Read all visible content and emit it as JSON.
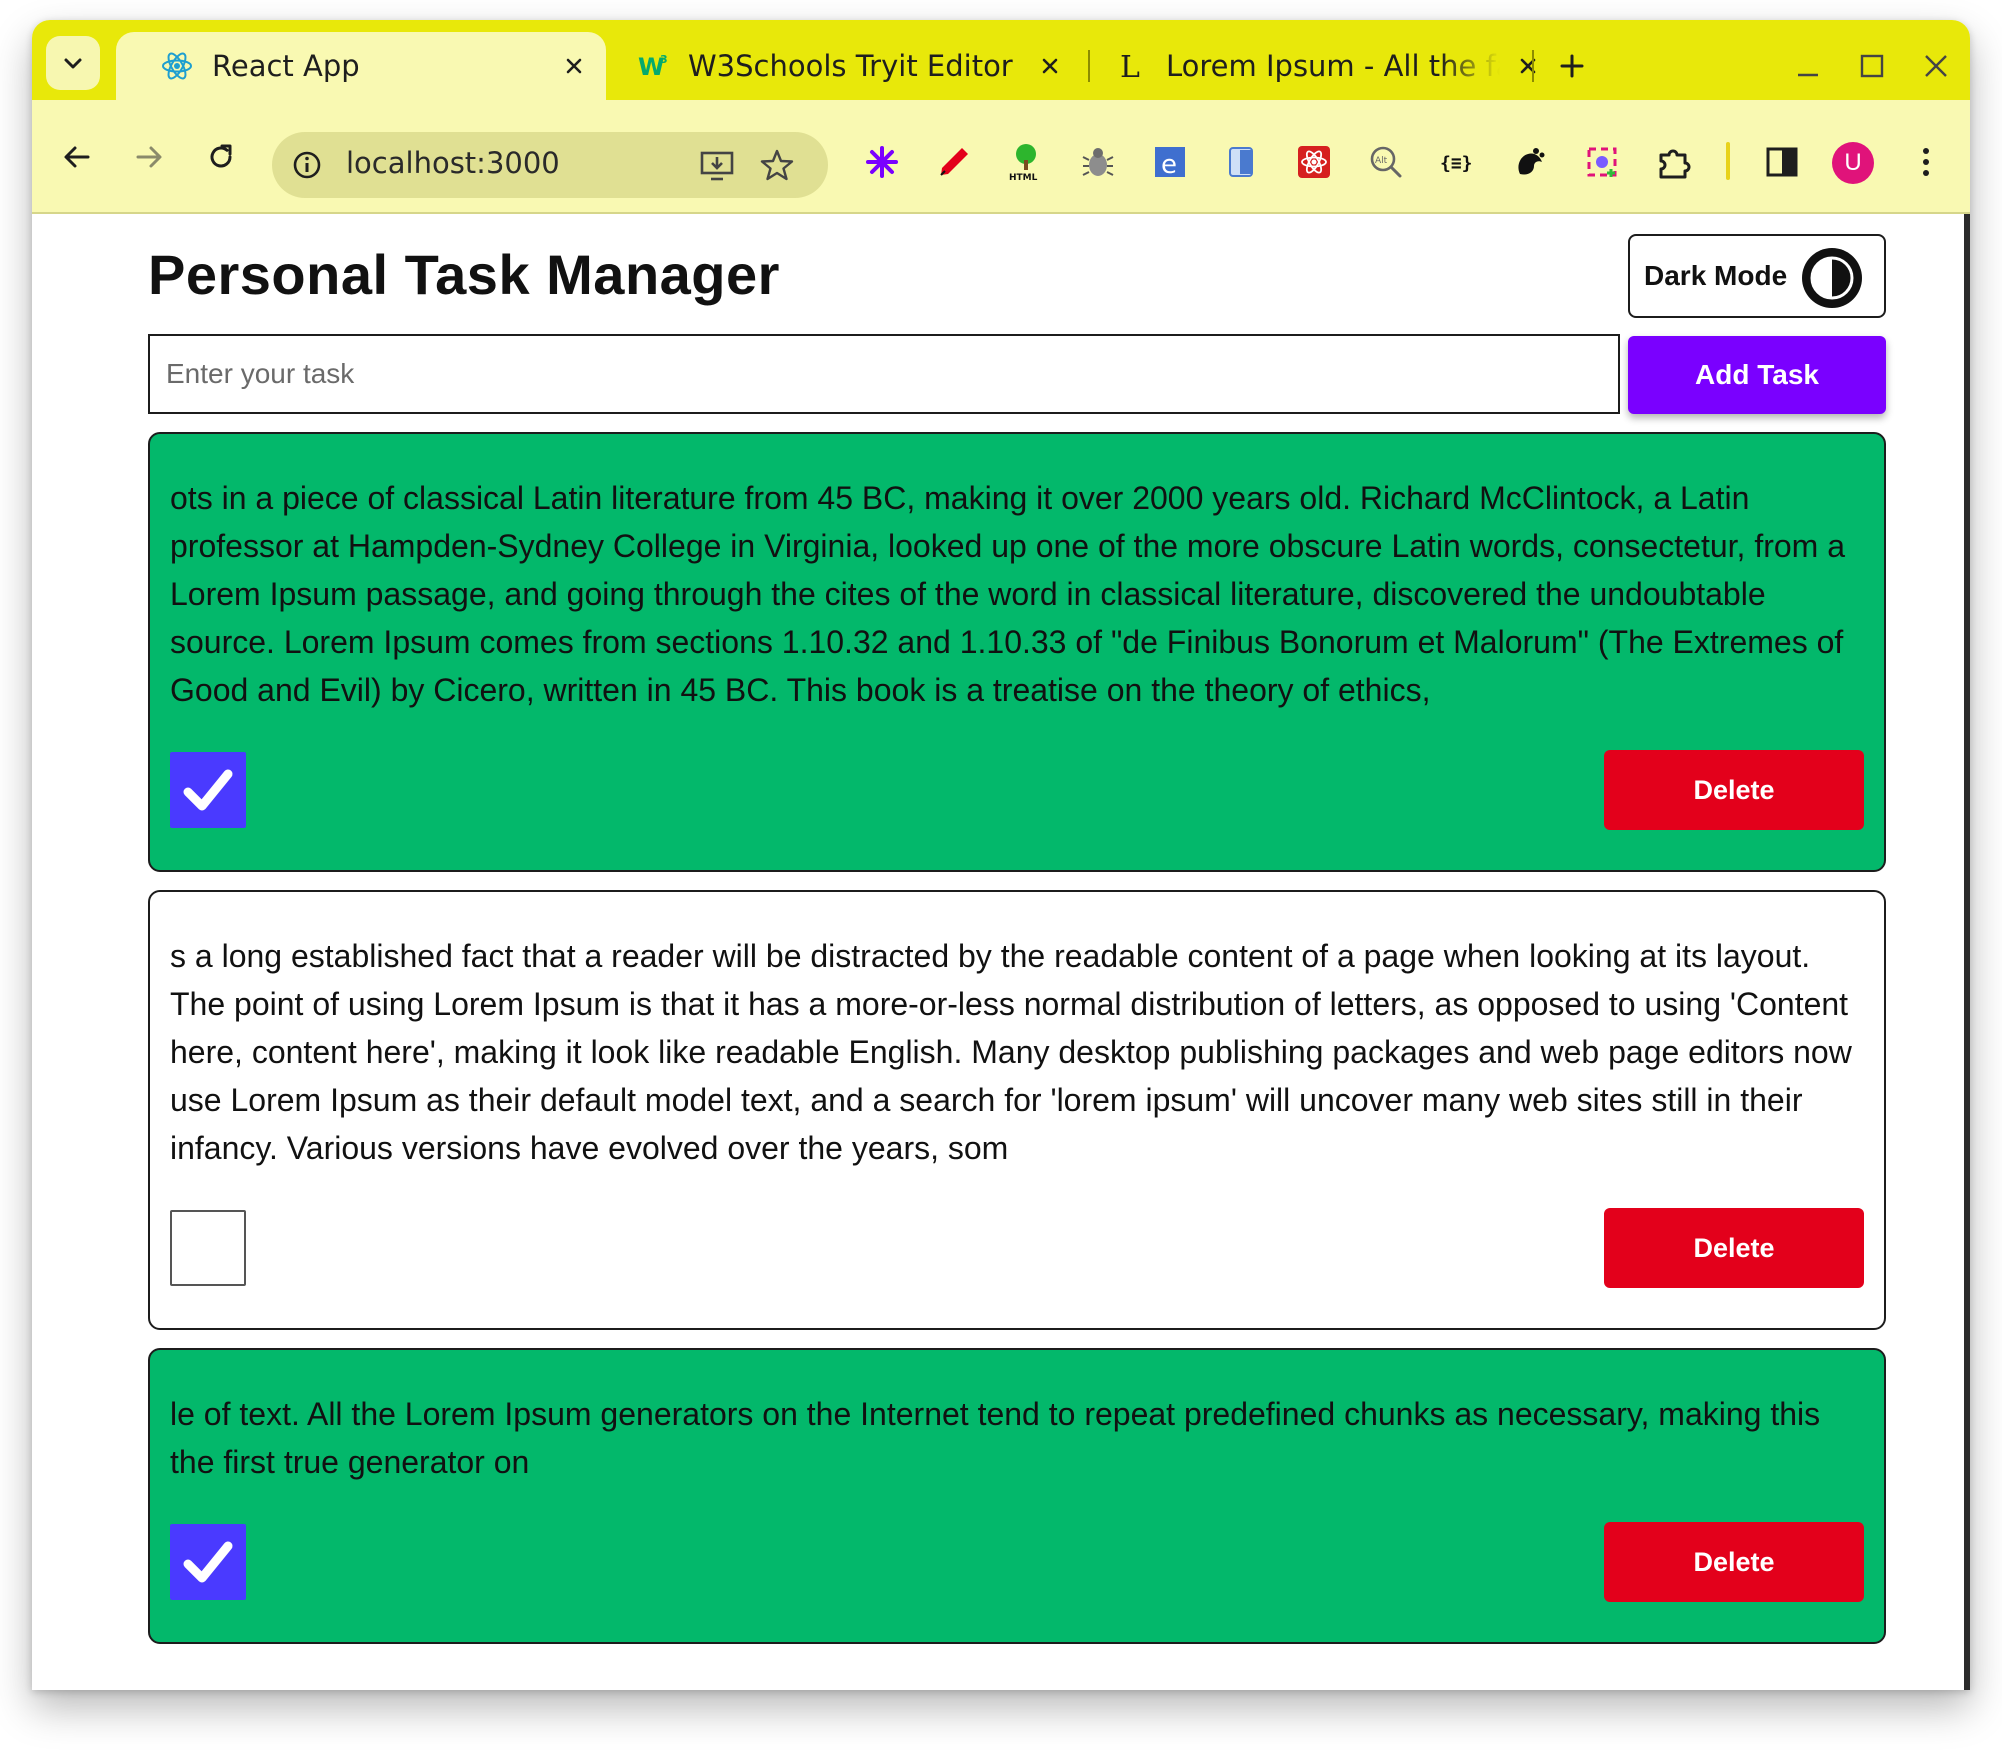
{
  "browser": {
    "tabs": [
      {
        "title": "React App",
        "icon": "react-icon",
        "active": true
      },
      {
        "title": "W3Schools Tryit Editor",
        "icon": "w3schools-icon",
        "active": false
      },
      {
        "title": "Lorem Ipsum - All the fac",
        "icon": "lorem-ipsum-icon",
        "active": false
      }
    ],
    "url": "localhost:3000",
    "avatar_initial": "U",
    "colors": {
      "frame": "#e8e80a",
      "toolbar": "#f9f9b2",
      "omnibox": "#e0e093"
    }
  },
  "app": {
    "title": "Personal Task Manager",
    "dark_mode_label": "Dark Mode",
    "input_placeholder": "Enter your task",
    "input_value": "",
    "add_button_label": "Add Task",
    "delete_label": "Delete",
    "colors": {
      "completed": "#03b86b",
      "add_button": "#7a00ff",
      "delete_button": "#e3001b",
      "checkbox": "#4a3aff"
    },
    "tasks": [
      {
        "text": "ots in a piece of classical Latin literature from 45 BC, making it over 2000 years old. Richard McClintock, a Latin professor at Hampden-Sydney College in Virginia, looked up one of the more obscure Latin words, consectetur, from a Lorem Ipsum passage, and going through the cites of the word in classical literature, discovered the undoubtable source. Lorem Ipsum comes from sections 1.10.32 and 1.10.33 of \"de Finibus Bonorum et Malorum\" (The Extremes of Good and Evil) by Cicero, written in 45 BC. This book is a treatise on the theory of ethics,",
        "completed": true
      },
      {
        "text": "s a long established fact that a reader will be distracted by the readable content of a page when looking at its layout. The point of using Lorem Ipsum is that it has a more-or-less normal distribution of letters, as opposed to using 'Content here, content here', making it look like readable English. Many desktop publishing packages and web page editors now use Lorem Ipsum as their default model text, and a search for 'lorem ipsum' will uncover many web sites still in their infancy. Various versions have evolved over the years, som",
        "completed": false
      },
      {
        "text": "le of text. All the Lorem Ipsum generators on the Internet tend to repeat predefined chunks as necessary, making this the first true generator on",
        "completed": true
      }
    ]
  }
}
